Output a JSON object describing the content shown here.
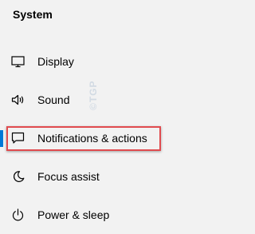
{
  "nav": {
    "section_title": "System",
    "items": [
      {
        "label": "Display",
        "icon": "monitor-icon"
      },
      {
        "label": "Sound",
        "icon": "speaker-icon"
      },
      {
        "label": "Notifications & actions",
        "icon": "message-icon",
        "selected": true,
        "highlighted": true
      },
      {
        "label": "Focus assist",
        "icon": "moon-icon"
      },
      {
        "label": "Power & sleep",
        "icon": "power-icon"
      }
    ]
  },
  "watermark": {
    "text": "©TGP"
  },
  "colors": {
    "background": "#f2f2f2",
    "text": "#000000",
    "accent": "#0078d7",
    "highlight_border": "#e04b4f"
  }
}
